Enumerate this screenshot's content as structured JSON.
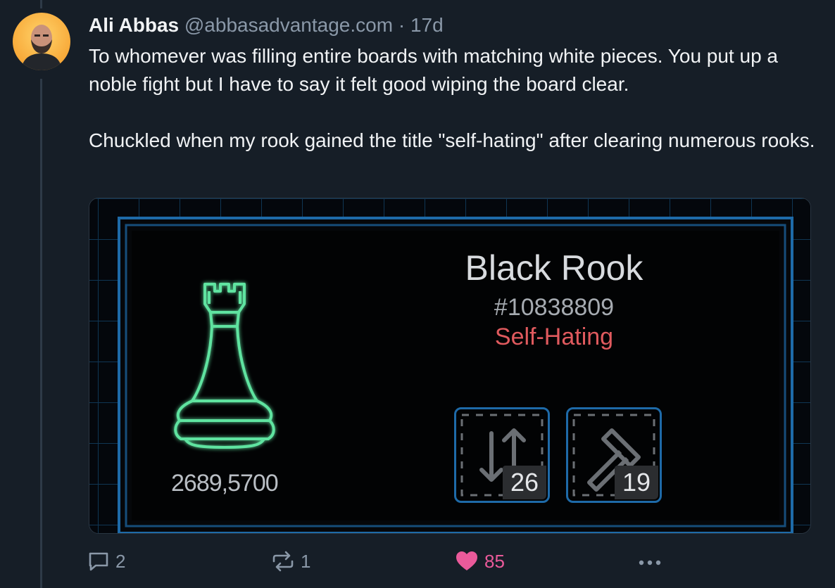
{
  "post": {
    "author_name": "Ali Abbas",
    "author_handle": "@abbasadvantage.com",
    "separator": "·",
    "age": "17d",
    "paragraphs": [
      "To whomever was filling entire boards with matching white pieces. You put up a noble fight but I have to say it felt good wiping the board clear.",
      "Chuckled when my rook gained the title \"self-hating\" after clearing numerous rooks."
    ]
  },
  "embed": {
    "piece_name": "Black Rook",
    "piece_id": "#10838809",
    "piece_title": "Self-Hating",
    "score": "2689,5700",
    "stats": [
      {
        "icon": "swap-arrows-icon",
        "value": "26"
      },
      {
        "icon": "hammer-icon",
        "value": "19"
      }
    ],
    "colors": {
      "neon_green": "#5fe3a0",
      "frame_blue": "#1e6aa8",
      "title_red": "#e05a5e"
    }
  },
  "actions": {
    "reply": {
      "icon": "reply-bubble-icon",
      "count": "2"
    },
    "repost": {
      "icon": "repost-icon",
      "count": "1"
    },
    "like": {
      "icon": "heart-icon",
      "count": "85",
      "liked": true
    },
    "more": {
      "icon": "more-dots-icon"
    }
  }
}
